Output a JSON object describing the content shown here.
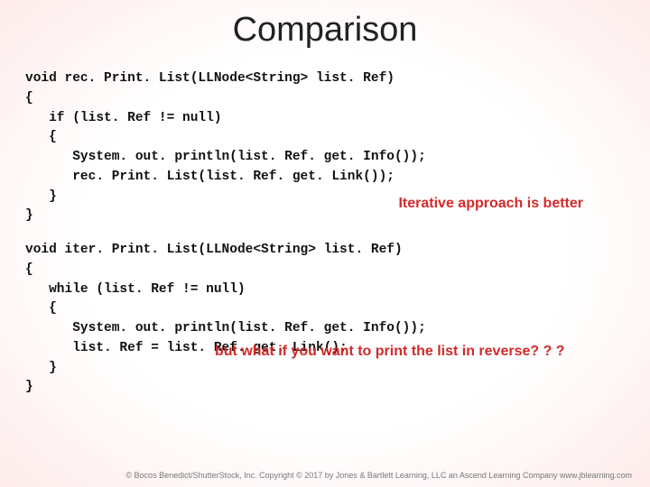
{
  "title": "Comparison",
  "code1_l1": "void rec. Print. List(LLNode<String> list. Ref)",
  "code1_l2": "{",
  "code1_l3": "   if (list. Ref != null)",
  "code1_l4": "   {",
  "code1_l5": "      System. out. println(list. Ref. get. Info());",
  "code1_l6": "      rec. Print. List(list. Ref. get. Link());",
  "code1_l7": "   }",
  "code1_l8": "}",
  "callout1": "Iterative approach is better",
  "code2_l1": "void iter. Print. List(LLNode<String> list. Ref)",
  "code2_l2": "{",
  "code2_l3": "   while (list. Ref != null)",
  "code2_l4": "   {",
  "code2_l5": "      System. out. println(list. Ref. get. Info());",
  "code2_l6": "      list. Ref = list. Ref. get. Link();",
  "code2_l7": "   }",
  "code2_l8": "}",
  "callout2": "but what if you want to print the list in reverse? ? ?",
  "footer": "© Bocos Benedict/ShutterStock, Inc. Copyright © 2017 by Jones & Bartlett Learning, LLC an Ascend Learning Company   www.jblearning.com"
}
